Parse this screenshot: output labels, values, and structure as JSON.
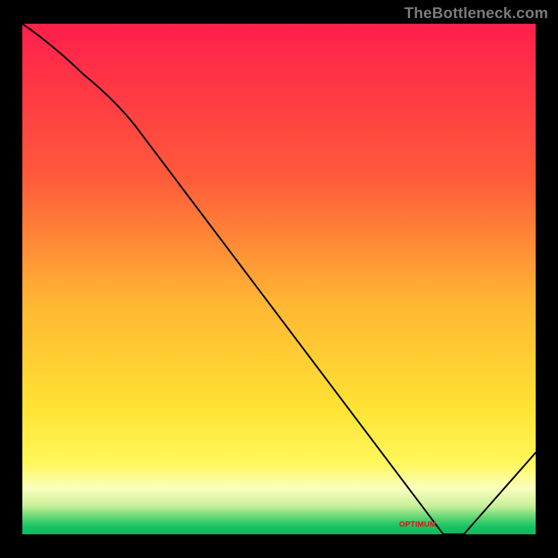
{
  "attribution": "TheBottleneck.com",
  "chart_data": {
    "type": "line",
    "title": "",
    "xlabel": "",
    "ylabel": "",
    "xlim": [
      0,
      100
    ],
    "ylim": [
      0,
      100
    ],
    "series": [
      {
        "name": "bottleneck-curve",
        "x": [
          0,
          12,
          22,
          82,
          86,
          100
        ],
        "y": [
          100,
          90,
          80,
          0,
          0,
          16
        ]
      }
    ],
    "optimum_band": {
      "x_start": 68,
      "x_end": 88
    },
    "gradient_stops": [
      {
        "offset": 0.0,
        "color": "#ff1f4c"
      },
      {
        "offset": 0.3,
        "color": "#ff5a3a"
      },
      {
        "offset": 0.55,
        "color": "#ffb733"
      },
      {
        "offset": 0.75,
        "color": "#ffe233"
      },
      {
        "offset": 0.86,
        "color": "#fff85a"
      },
      {
        "offset": 0.91,
        "color": "#fbffbe"
      },
      {
        "offset": 0.945,
        "color": "#c7f09a"
      },
      {
        "offset": 0.965,
        "color": "#68d977"
      },
      {
        "offset": 0.985,
        "color": "#17c364"
      },
      {
        "offset": 1.0,
        "color": "#0fb95c"
      }
    ],
    "optimum_label": "OPTIMUM"
  }
}
